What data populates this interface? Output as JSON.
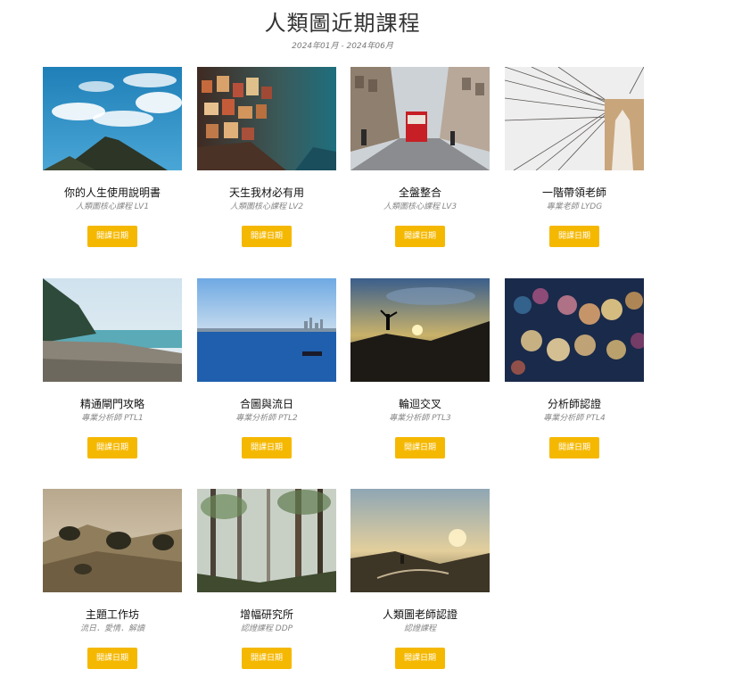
{
  "page": {
    "title": "人類圖近期課程",
    "subtitle": "2024年01月 - 2024年06月"
  },
  "courses": [
    {
      "title": "你的人生使用說明書",
      "subtitle": "人類圖核心課程 LV1",
      "button": "開課日期",
      "image": "mountain-sky-image"
    },
    {
      "title": "天生我材必有用",
      "subtitle": "人類圖核心課程 LV2",
      "button": "開課日期",
      "image": "cliff-village-image"
    },
    {
      "title": "全盤整合",
      "subtitle": "人類圖核心課程 LV3",
      "button": "開課日期",
      "image": "tram-street-image"
    },
    {
      "title": "一階帶領老師",
      "subtitle": "專業老師 LYDG",
      "button": "開課日期",
      "image": "bridge-cables-image"
    },
    {
      "title": "精通閘門攻略",
      "subtitle": "專業分析師 PTL1",
      "button": "開課日期",
      "image": "beach-shore-image"
    },
    {
      "title": "合圖與流日",
      "subtitle": "專業分析師 PTL2",
      "button": "開課日期",
      "image": "sea-skyline-image"
    },
    {
      "title": "輪迴交叉",
      "subtitle": "專業分析師 PTL3",
      "button": "開課日期",
      "image": "sunset-jump-image"
    },
    {
      "title": "分析師認證",
      "subtitle": "專業分析師 PTL4",
      "button": "開課日期",
      "image": "bokeh-lights-image"
    },
    {
      "title": "主題工作坊",
      "subtitle": "流日．愛情．解讀",
      "button": "開課日期",
      "image": "hills-trees-image"
    },
    {
      "title": "增幅研究所",
      "subtitle": "認證課程 DDP",
      "button": "開課日期",
      "image": "forest-fog-image"
    },
    {
      "title": "人類圖老師認證",
      "subtitle": "認證課程",
      "button": "開課日期",
      "image": "valley-sunset-image"
    }
  ],
  "colors": {
    "button": "#f5b800",
    "title": "#333333",
    "subtitle": "#888888"
  }
}
